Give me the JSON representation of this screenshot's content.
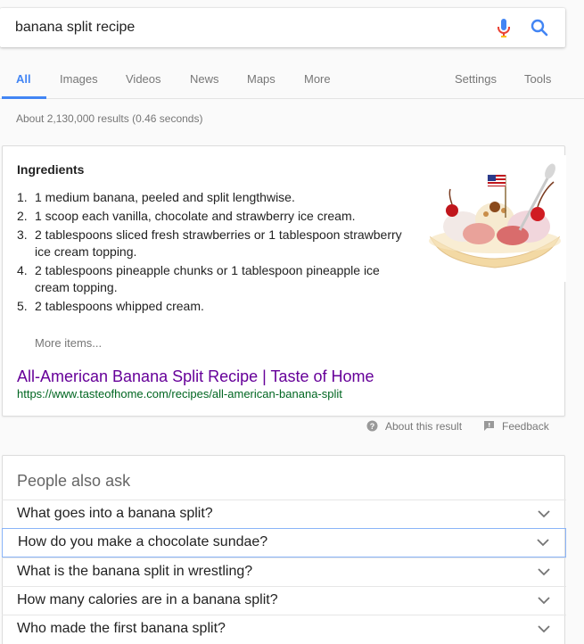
{
  "search": {
    "query": "banana split recipe"
  },
  "tabs": [
    {
      "label": "All"
    },
    {
      "label": "Images"
    },
    {
      "label": "Videos"
    },
    {
      "label": "News"
    },
    {
      "label": "Maps"
    },
    {
      "label": "More"
    },
    {
      "label": "Settings"
    },
    {
      "label": "Tools"
    }
  ],
  "active_tab": "All",
  "stats": "About 2,130,000 results (0.46 seconds)",
  "snippet": {
    "heading": "Ingredients",
    "items": [
      {
        "num": "1.",
        "text": "1 medium banana, peeled and split lengthwise."
      },
      {
        "num": "2.",
        "text": "1 scoop each vanilla, chocolate and strawberry ice cream."
      },
      {
        "num": "3.",
        "text": "2 tablespoons sliced fresh strawberries or 1 tablespoon strawberry ice cream topping."
      },
      {
        "num": "4.",
        "text": "2 tablespoons pineapple chunks or 1 tablespoon pineapple ice cream topping."
      },
      {
        "num": "5.",
        "text": "2 tablespoons whipped cream."
      }
    ],
    "more_items": "More items...",
    "title": "All-American Banana Split Recipe | Taste of Home",
    "url": "https://www.tasteofhome.com/recipes/all-american-banana-split"
  },
  "about_result": "About this result",
  "feedback": "Feedback",
  "people_also_ask": {
    "title": "People also ask",
    "questions": [
      "What goes into a banana split?",
      "How do you make a chocolate sundae?",
      "What is the banana split in wrestling?",
      "How many calories are in a banana split?",
      "Who made the first banana split?"
    ]
  },
  "colors": {
    "accent": "#4285f4",
    "visited_link": "#660099",
    "url_green": "#006621",
    "muted": "#777777"
  },
  "icons": [
    "mic-icon",
    "search-icon",
    "help-icon",
    "feedback-icon",
    "chevron-down-icon",
    "banana-split-thumbnail"
  ]
}
